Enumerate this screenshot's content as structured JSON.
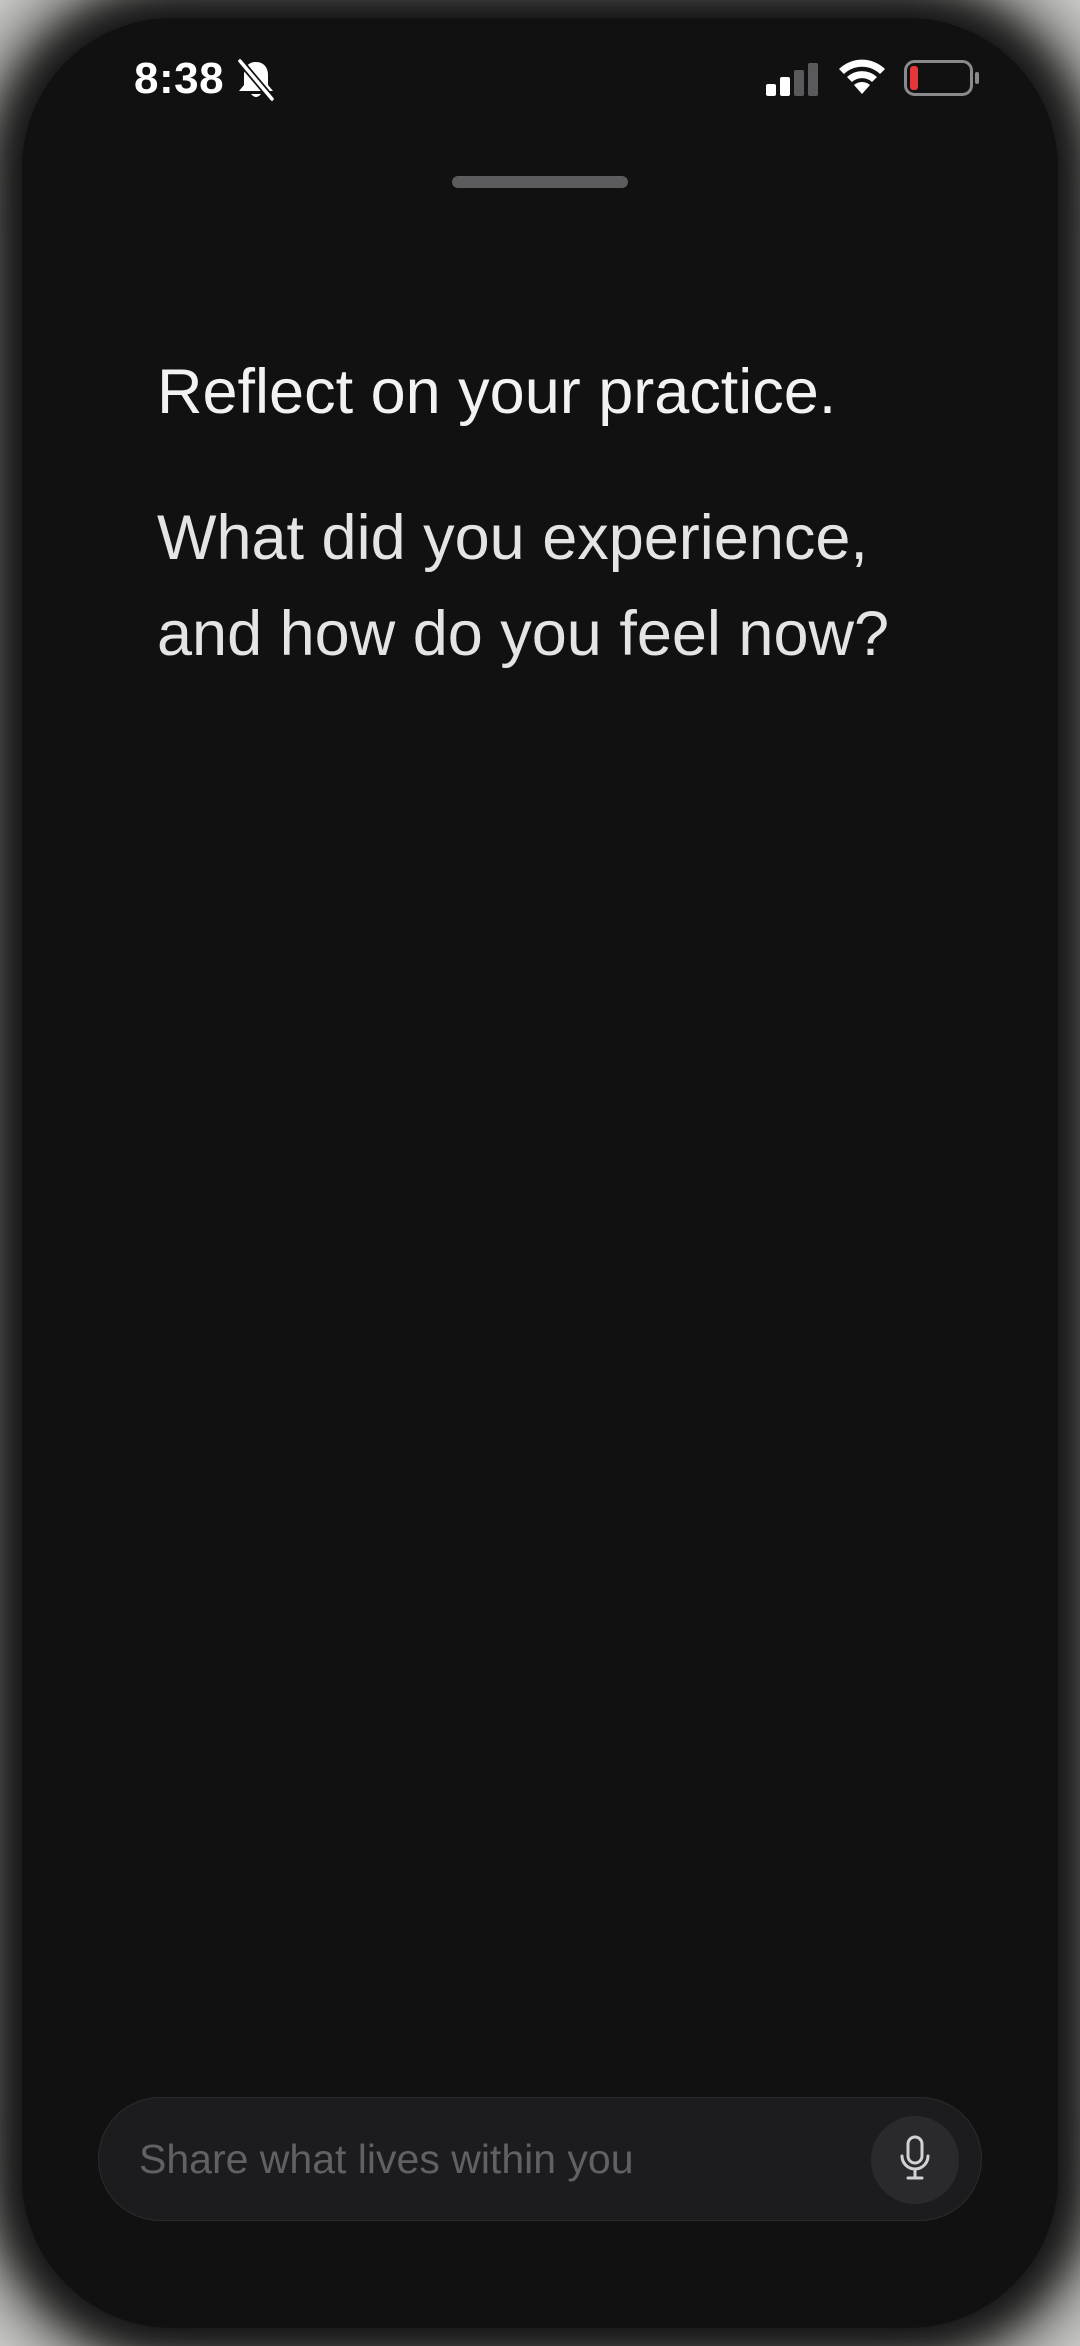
{
  "status_bar": {
    "time": "8:38",
    "icons": [
      "bell-slash-icon",
      "cellular-signal-icon",
      "wifi-icon",
      "battery-low-icon"
    ],
    "battery_color": "#e5373a"
  },
  "prompt": {
    "heading": "Reflect on your practice.",
    "question": "What did you experience, and how do you feel now?"
  },
  "composer": {
    "placeholder": "Share what lives within you",
    "value": "",
    "mic_icon": "microphone-icon"
  },
  "colors": {
    "background": "#111111",
    "input_background": "#1c1c1e",
    "text": "#f2f2f2",
    "placeholder": "#616164"
  }
}
